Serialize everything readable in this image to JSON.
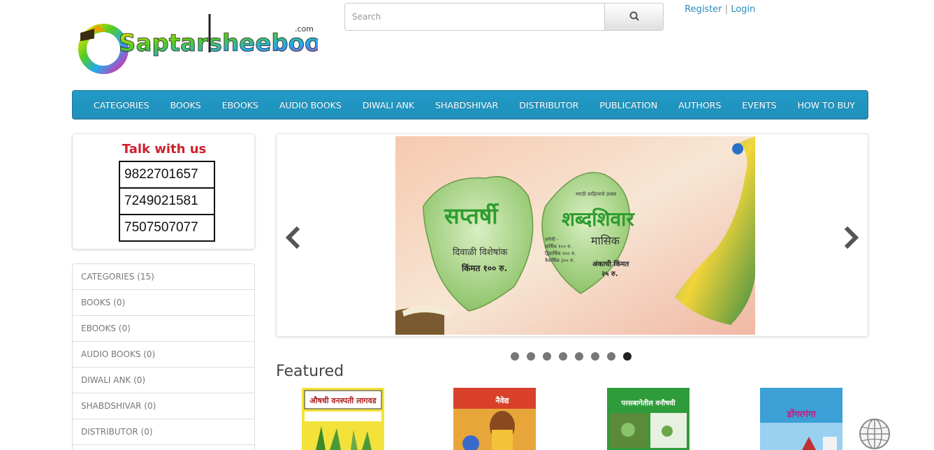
{
  "header": {
    "logo_text": "Saptarsheebooks",
    "logo_suffix": ".com",
    "search_placeholder": "Search",
    "register_label": "Register",
    "separator": "|",
    "login_label": "Login"
  },
  "nav": {
    "items": [
      "CATEGORIES",
      "BOOKS",
      "EBOOKS",
      "AUDIO BOOKS",
      "DIWALI ANK",
      "SHABDSHIVAR",
      "DISTRIBUTOR",
      "PUBLICATION",
      "AUTHORS",
      "EVENTS",
      "HOW TO BUY"
    ]
  },
  "talk": {
    "title": "Talk with us",
    "phones": [
      "9822701657",
      "7249021581",
      "7507507077"
    ]
  },
  "categories": [
    "CATEGORIES (15)",
    "BOOKS (0)",
    "EBOOKS (0)",
    "AUDIO BOOKS (0)",
    "DIWALI ANK (0)",
    "SHABDSHIVAR (0)",
    "DISTRIBUTOR (0)"
  ],
  "carousel": {
    "slide_count": 8,
    "active_index": 7,
    "banner": {
      "left_leaf_title": "सप्तर्षी",
      "left_leaf_sub": "दिवाळी विशेषांक",
      "left_leaf_price": "किंमत १०० रु.",
      "right_leaf_top": "मराठी साहित्याचे उत्सव",
      "right_leaf_title": "शब्दशिवार",
      "right_leaf_sub": "मासिक",
      "right_leaf_lines": [
        "वर्गणी -",
        "वार्षिक १०० रु.",
        "द्विवार्षिक १०० रु.",
        "त्रैवार्षिक ३०० रु."
      ],
      "right_leaf_price": "अंकाची किंमत",
      "right_leaf_price2": "२५ रु."
    }
  },
  "featured": {
    "title": "Featured",
    "books": [
      {
        "cover_title": "औषधी वनस्पती लागवड",
        "bg": "#f2e23a"
      },
      {
        "cover_title": "नैवेद्य",
        "bg": "#e8a63a"
      },
      {
        "cover_title": "परसबागेतील वनौषधी",
        "bg": "#2e9c3a"
      },
      {
        "cover_title": "डोंगरगंगा",
        "bg": "#3aa0d6"
      }
    ]
  },
  "colors": {
    "nav_bg": "#229ac8",
    "link": "#2a8dc0",
    "talk_title": "#d0202e"
  }
}
